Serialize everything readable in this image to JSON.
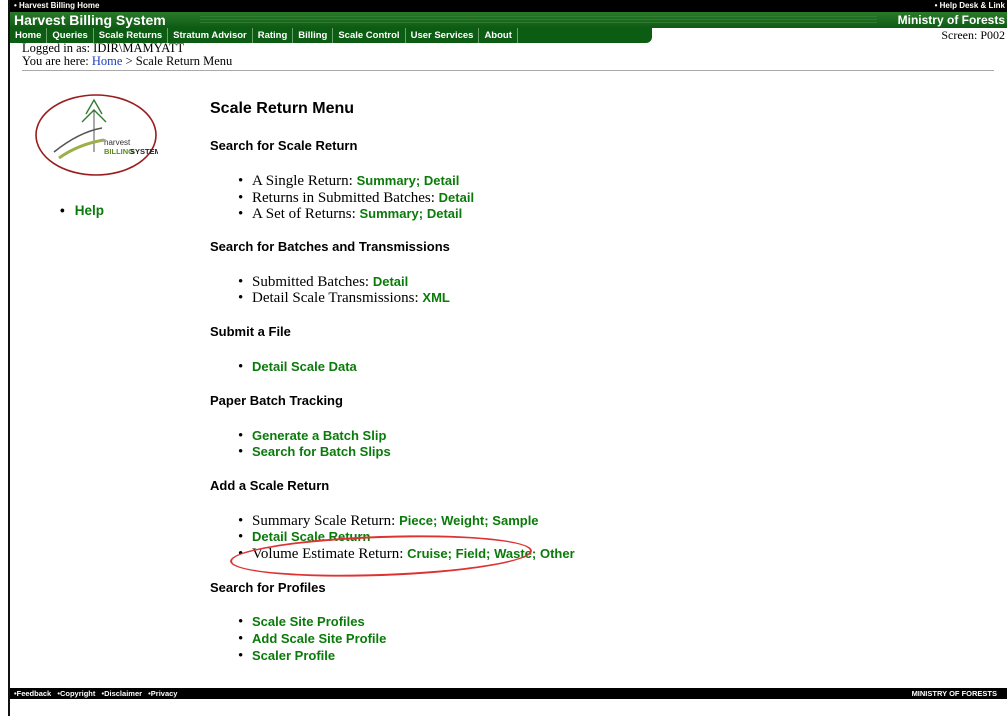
{
  "topbar": {
    "left": "• Harvest Billing Home",
    "right": "• Help Desk & Link"
  },
  "titlebar": {
    "app": "Harvest Billing System",
    "ministry": "Ministry of Forests"
  },
  "menu": [
    "Home",
    "Queries",
    "Scale Returns",
    "Stratum Advisor",
    "Rating",
    "Billing",
    "Scale Control",
    "User Services",
    "About"
  ],
  "screen": "Screen: P002",
  "login": "Logged in as: IDIR\\MAMYATT",
  "breadcrumb": {
    "prefix": "You are here:",
    "home": "Home",
    "current": "> Scale Return Menu"
  },
  "logo": {
    "text1": "harvest",
    "text2": "BILLING",
    "text3": "SYSTEM"
  },
  "sidebar": {
    "help": "Help"
  },
  "page_title": "Scale Return Menu",
  "sections": {
    "search_return": "Search for Scale Return",
    "search_batches": "Search for Batches and Transmissions",
    "submit": "Submit a File",
    "paper": "Paper Batch Tracking",
    "add": "Add a Scale Return",
    "profiles": "Search for Profiles"
  },
  "rows": {
    "single": {
      "label": "A Single Return:",
      "l1": "Summary;",
      "l2": "Detail"
    },
    "submitted_returns": {
      "label": "Returns in Submitted Batches:",
      "l1": "Detail"
    },
    "set": {
      "label": "A Set of Returns:",
      "l1": "Summary;",
      "l2": "Detail"
    },
    "batches": {
      "label": "Submitted Batches:",
      "l1": "Detail"
    },
    "transmissions": {
      "label": "Detail Scale Transmissions:",
      "l1": "XML"
    },
    "detail_data": "Detail Scale Data",
    "gen_slip": "Generate a Batch Slip",
    "search_slips": "Search for Batch Slips",
    "summary_return": {
      "label": "Summary Scale Return:",
      "l1": "Piece;",
      "l2": "Weight;",
      "l3": "Sample"
    },
    "detail_return": "Detail Scale Return",
    "volume": {
      "label": "Volume Estimate Return:",
      "l1": "Cruise;",
      "l2": "Field;",
      "l3": "Waste;",
      "l4": "Other"
    },
    "site_profiles": "Scale Site Profiles",
    "add_site": "Add Scale Site Profile",
    "scaler": "Scaler Profile"
  },
  "footer": {
    "links": [
      "•Feedback",
      "•Copyright",
      "•Disclaimer",
      "•Privacy"
    ],
    "right": "MINISTRY OF FORESTS"
  },
  "colors": {
    "brand_green": "#0d5c14",
    "link_green": "#0a7a0a",
    "highlight": "#dd3333"
  }
}
